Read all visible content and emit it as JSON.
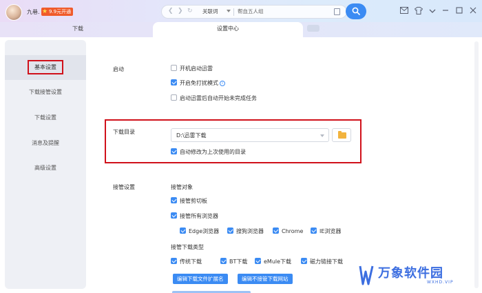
{
  "header": {
    "username": "九巷.",
    "vip_badge": "9.9元开通",
    "nav": {
      "keyword_tag": "关联词",
      "search_text": "帮血五人组"
    }
  },
  "tabs": [
    {
      "label": "下载"
    },
    {
      "label": "设置中心"
    }
  ],
  "sidebar": {
    "items": [
      {
        "label": "基本设置"
      },
      {
        "label": "下载接管设置"
      },
      {
        "label": "下载设置"
      },
      {
        "label": "消息及提醒"
      },
      {
        "label": "高级设置"
      }
    ]
  },
  "settings": {
    "startup": {
      "label": "启动",
      "options": [
        {
          "label": "开机启动迅雷",
          "checked": false
        },
        {
          "label": "开启免打扰模式",
          "checked": true
        },
        {
          "label": "启动迅雷后自动开始未完成任务",
          "checked": false
        }
      ]
    },
    "download_dir": {
      "label": "下载目录",
      "value": "D:\\迅雷下载",
      "auto_option": {
        "label": "自动修改为上次使用的目录",
        "checked": true
      }
    },
    "takeover": {
      "label": "接管设置",
      "object_heading": "接管对象",
      "clipboard": {
        "label": "接管剪切板",
        "checked": true
      },
      "all_browsers": {
        "label": "接管所有浏览器",
        "checked": true
      },
      "browsers": [
        {
          "label": "Edge浏览器",
          "checked": true
        },
        {
          "label": "搜狗浏览器",
          "checked": true
        },
        {
          "label": "Chrome",
          "checked": true
        },
        {
          "label": "IE浏览器",
          "checked": true
        }
      ],
      "type_heading": "接管下载类型",
      "types": [
        {
          "label": "传统下载",
          "checked": true
        },
        {
          "label": "BT下载",
          "checked": true
        },
        {
          "label": "eMule下载",
          "checked": true
        },
        {
          "label": "磁力链接下载",
          "checked": true
        }
      ],
      "btn_edit_ext": "编辑下载文件扩展名",
      "btn_edit_sites": "编辑不接管下载网站"
    }
  },
  "watermark": {
    "title": "万象软件园",
    "sub": "WXHD.VIP"
  },
  "colors": {
    "accent": "#3b8bf3",
    "highlight_red": "#d0101a",
    "vip": "#f05a2a"
  }
}
